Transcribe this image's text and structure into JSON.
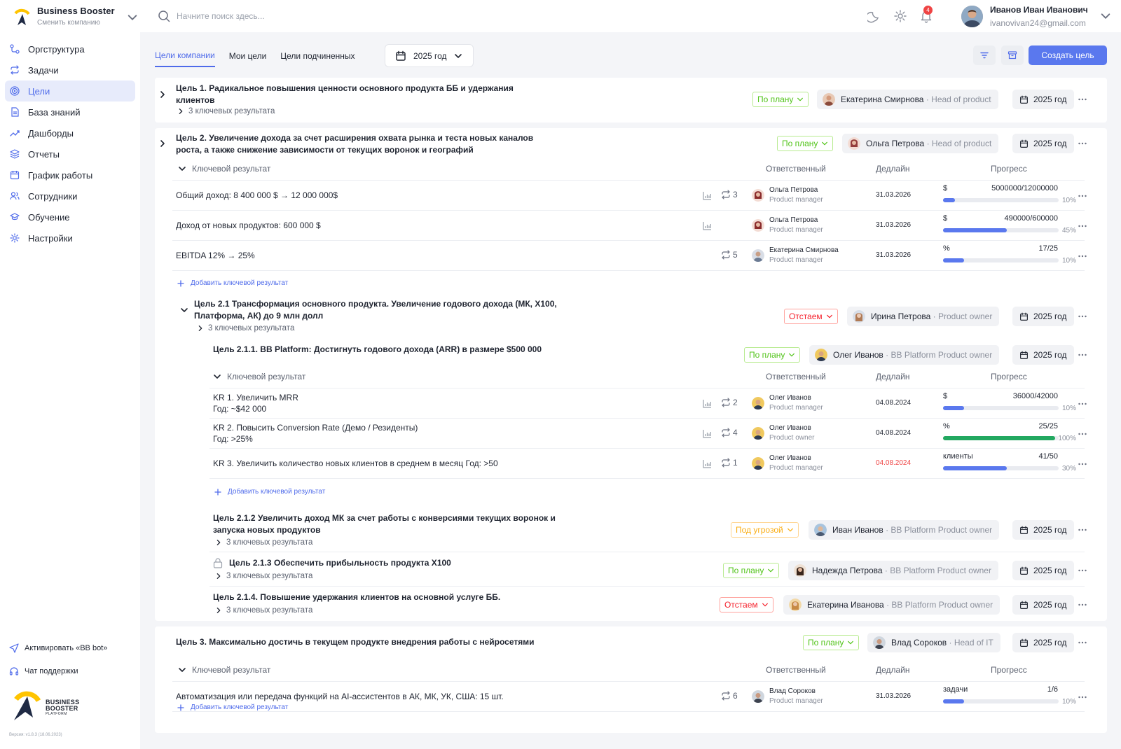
{
  "company": {
    "name": "Business Booster",
    "switch_label": "Сменить компанию"
  },
  "nav": [
    {
      "label": "Оргструктура",
      "icon": "org-icon"
    },
    {
      "label": "Задачи",
      "icon": "tasks-icon"
    },
    {
      "label": "Цели",
      "icon": "target-icon",
      "active": true
    },
    {
      "label": "База знаний",
      "icon": "book-icon"
    },
    {
      "label": "Дашборды",
      "icon": "chart-line-icon"
    },
    {
      "label": "Отчеты",
      "icon": "layers-icon"
    },
    {
      "label": "График работы",
      "icon": "calendar-icon"
    },
    {
      "label": "Сотрудники",
      "icon": "users-icon"
    },
    {
      "label": "Обучение",
      "icon": "graduation-icon"
    },
    {
      "label": "Настройки",
      "icon": "gear-icon"
    }
  ],
  "sidebar_bottom": {
    "bot_label": "Активировать «BB bot»",
    "support_label": "Чат поддержки",
    "logo_line1": "BUSINESS",
    "logo_line2": "BOOSTER",
    "logo_line3": "PLATFORM",
    "version": "Версия: v1.8.3 (18.06.2023)"
  },
  "search": {
    "placeholder": "Начните поиск здесь..."
  },
  "notifications": {
    "count": "4"
  },
  "user": {
    "name": "Иванов Иван Иванович",
    "email": "ivanovivan24@gmail.com"
  },
  "tabs": [
    {
      "label": "Цели компании",
      "active": true
    },
    {
      "label": "Мои цели"
    },
    {
      "label": "Цели подчиненных"
    }
  ],
  "year_filter": "2025 год",
  "create_button": "Создать цель",
  "headers": {
    "kr": "Ключевой результат",
    "resp": "Ответственный",
    "deadline": "Дедлайн",
    "progress": "Прогресс"
  },
  "add_kr_label": "Добавить ключевой результат",
  "colors": {
    "accent": "#5a78ee",
    "on_plan": "#52c41a",
    "lagging": "#f5222d",
    "at_risk": "#faad14",
    "complete": "#22a860"
  },
  "goals": {
    "g1": {
      "title": "Цель 1. Радикальное повышения ценности основного продукта ББ и удержания клиентов",
      "kr_count": "3 ключевых результата",
      "status": "По плану",
      "owner_name": "Екатерина Смирнова",
      "owner_role": "· Head of product",
      "year": "2025 год"
    },
    "g2": {
      "title": "Цель 2. Увеличение дохода за счет расширения охвата рынка и теста новых каналов роста, а также снижение зависимости от текущих воронок и географий",
      "status": "По плану",
      "owner_name": "Ольга Петрова",
      "owner_role": "· Head of product",
      "year": "2025 год",
      "krs": [
        {
          "text": "Общий доход: 8 400 000 $ → 12 000 000$",
          "count": "3",
          "resp_name": "Ольга Петрова",
          "resp_role": "Product manager",
          "deadline": "31.03.2026",
          "unit": "$",
          "value": "5000000/12000000",
          "pct": "10%",
          "fill": 0.1
        },
        {
          "text": "Доход от новых продуктов: 600 000 $",
          "count": "",
          "resp_name": "Ольга Петрова",
          "resp_role": "Product manager",
          "deadline": "31.03.2026",
          "unit": "$",
          "value": "490000/600000",
          "pct": "45%",
          "fill": 0.55
        },
        {
          "text": "EBITDA 12% →  25%",
          "count": "5",
          "resp_name": "Екатерина Смирнова",
          "resp_role": "Product manager",
          "deadline": "31.03.2026",
          "unit": "%",
          "value": "17/25",
          "pct": "10%",
          "fill": 0.18
        }
      ]
    },
    "g21": {
      "title": "Цель 2.1 Трансформация основного продукта. Увеличение годового дохода (МК, X100, Платформа, АК) до 9 млн долл",
      "kr_count": "3 ключевых результата",
      "status": "Отстаем",
      "owner_name": "Ирина Петрова",
      "owner_role": "· Product owner",
      "year": "2025 год"
    },
    "g211": {
      "title": "Цель 2.1.1. BB Platform: Достигнуть годового дохода (ARR) в размере $500 000",
      "status": "По плану",
      "owner_name": "Олег Иванов",
      "owner_role": "· BB Platform Product owner",
      "year": "2025 год",
      "krs": [
        {
          "line1": "KR 1. Увеличить MRR",
          "line2": "Год: ~$42 000",
          "count": "2",
          "resp_name": "Олег Иванов",
          "resp_role": "Product manager",
          "deadline": "04.08.2024",
          "unit": "$",
          "value": "36000/42000",
          "pct": "10%",
          "fill": 0.18
        },
        {
          "line1": "KR 2. Повысить Conversion Rate (Демо / Резиденты)",
          "line2": "Год: >25%",
          "count": "4",
          "resp_name": "Олег Иванов",
          "resp_role": "Product owner",
          "deadline": "04.08.2024",
          "unit": "%",
          "value": "25/25",
          "pct": "100%",
          "fill": 0.97,
          "complete": true
        },
        {
          "line1": "KR 3. Увеличить количество новых клиентов в среднем в месяц Год: >50",
          "line2": "",
          "count": "1",
          "resp_name": "Олег Иванов",
          "resp_role": "Product manager",
          "deadline": "04.08.2024",
          "overdue": true,
          "unit": "клиенты",
          "value": "41/50",
          "pct": "30%",
          "fill": 0.55
        }
      ]
    },
    "g212": {
      "title": "Цель 2.1.2 Увеличить доход МК за счет работы с конверсиями текущих воронок и запуска новых продуктов",
      "kr_count": "3 ключевых результата",
      "status": "Под угрозой",
      "owner_name": "Иван Иванов",
      "owner_role": "· BB Platform Product owner",
      "year": "2025 год"
    },
    "g213": {
      "title": "Цель 2.1.3 Обеспечить прибыльность продукта X100",
      "kr_count": "3 ключевых результата",
      "status": "По плану",
      "owner_name": "Надежда Петрова",
      "owner_role": "· BB Platform Product owner",
      "year": "2025 год"
    },
    "g214": {
      "title": "Цель 2.1.4. Повышение удержания клиентов на основной услуге ББ.",
      "kr_count": "3 ключевых результата",
      "status": "Отстаем",
      "owner_name": "Екатерина Иванова",
      "owner_role": "· BB Platform Product owner",
      "year": "2025 год"
    },
    "g3": {
      "title": "Цель 3. Максимально достичь в текущем продукте внедрения работы с нейросетями",
      "status": "По плану",
      "owner_name": "Влад Сороков",
      "owner_role": "· Head of IT",
      "year": "2025 год",
      "krs": [
        {
          "text": "Автоматизация или передача функций на AI-ассистентов в АК, МК, УК, США: 15 шт.",
          "count": "6",
          "resp_name": "Влад Сороков",
          "resp_role": "Product manager",
          "deadline": "31.03.2026",
          "unit": "задачи",
          "value": "1/6",
          "pct": "10%",
          "fill": 0.18
        }
      ]
    }
  }
}
